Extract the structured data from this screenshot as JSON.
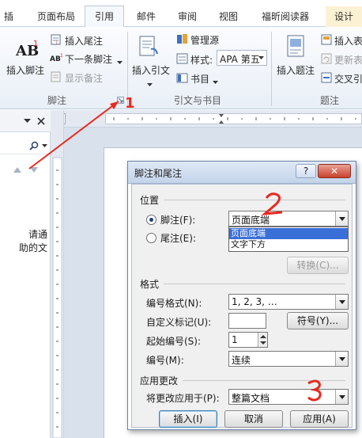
{
  "tabs": {
    "insert_partial": "插入",
    "layout": "页面布局",
    "references": "引用",
    "mailings": "邮件",
    "review": "审阅",
    "view": "视图",
    "foxit": "福昕阅读器",
    "design": "设计"
  },
  "ribbon": {
    "footnotes_group": {
      "label": "脚注",
      "insert_footnote": "插入脚注",
      "insert_endnote": "插入尾注",
      "next_footnote": "下一条脚注",
      "show_notes": "显示备注"
    },
    "citations_group": {
      "label": "引文与书目",
      "insert_citation": "插入引文",
      "manage_sources": "管理源",
      "style_label": "样式:",
      "style_value": "APA 第五",
      "bibliography": "书目"
    },
    "captions_group": {
      "label": "题注",
      "insert_caption": "插入题注",
      "insert_table_of_figures": "插入表",
      "update_table": "更新表",
      "cross_reference": "交叉引"
    }
  },
  "navpane": {
    "text_line1": "请通",
    "text_line2": "助的文"
  },
  "dialog": {
    "title": "脚注和尾注",
    "help": "?",
    "close": "✕",
    "location_section": "位置",
    "footnote_label": "脚注(F):",
    "footnote_value": "页面底端",
    "endnote_label": "尾注(E):",
    "dropdown_options": [
      "页面底端",
      "文字下方"
    ],
    "convert_button": "转换(C)...",
    "format_section": "格式",
    "number_format_label": "编号格式(N):",
    "number_format_value": "1, 2, 3, …",
    "custom_mark_label": "自定义标记(U):",
    "symbol_button": "符号(Y)...",
    "start_at_label": "起始编号(S):",
    "start_at_value": "1",
    "numbering_label": "编号(M):",
    "numbering_value": "连续",
    "apply_section": "应用更改",
    "apply_to_label": "将更改应用于(P):",
    "apply_to_value": "整篇文档",
    "insert_button": "插入(I)",
    "cancel_button": "取消",
    "apply_button": "应用(A)"
  },
  "annotations": {
    "marker_1": "1",
    "marker_2": "2",
    "marker_3": "3"
  },
  "colors": {
    "ribbon_bg": "#e9eff7",
    "annotation_red": "#e8291f",
    "selection_blue": "#3a6fd8"
  }
}
